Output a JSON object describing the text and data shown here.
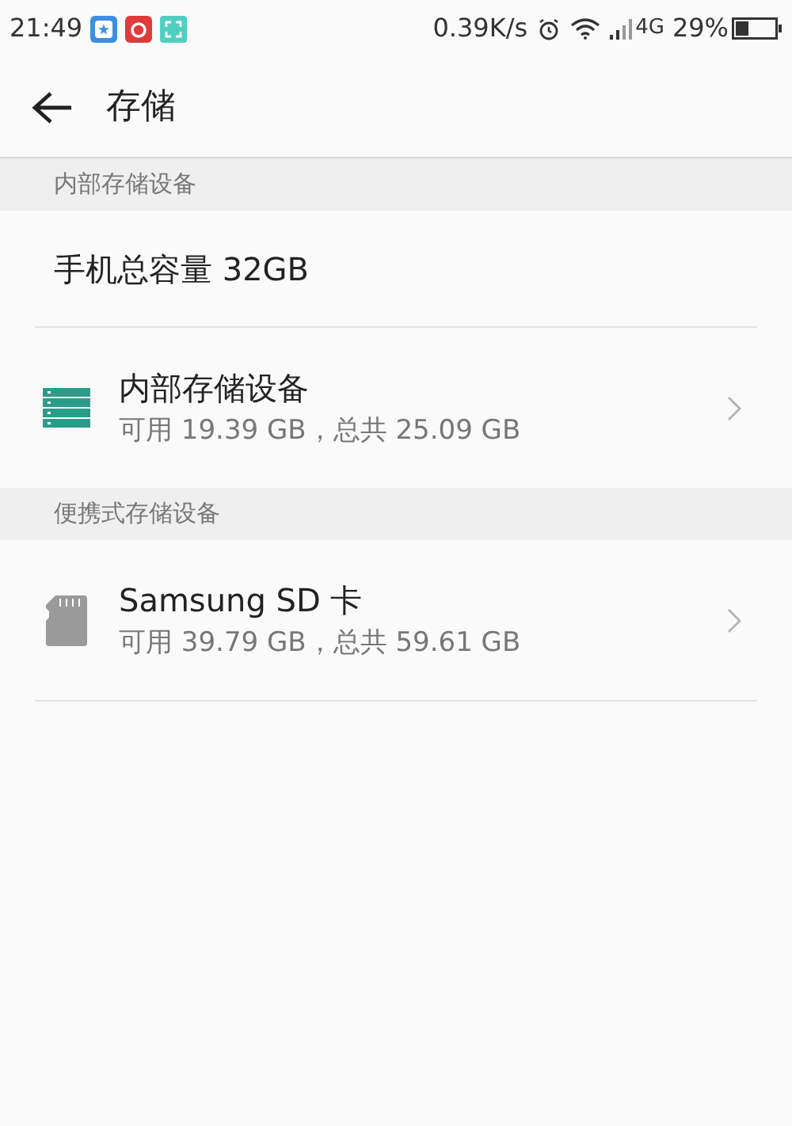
{
  "status_bar": {
    "time": "21:49",
    "network_speed": "0.39K/s",
    "network_type": "4G",
    "battery": "29%"
  },
  "header": {
    "title": "存储"
  },
  "sections": [
    {
      "title": "内部存储设备",
      "items": [
        {
          "kind": "text",
          "title": "手机总容量 32GB"
        },
        {
          "kind": "internal",
          "title": "内部存储设备",
          "subtitle": "可用 19.39 GB，总共 25.09 GB"
        }
      ]
    },
    {
      "title": "便携式存储设备",
      "items": [
        {
          "kind": "sdcard",
          "title": "Samsung SD 卡",
          "subtitle": "可用 39.79 GB，总共 59.61 GB"
        }
      ]
    }
  ]
}
